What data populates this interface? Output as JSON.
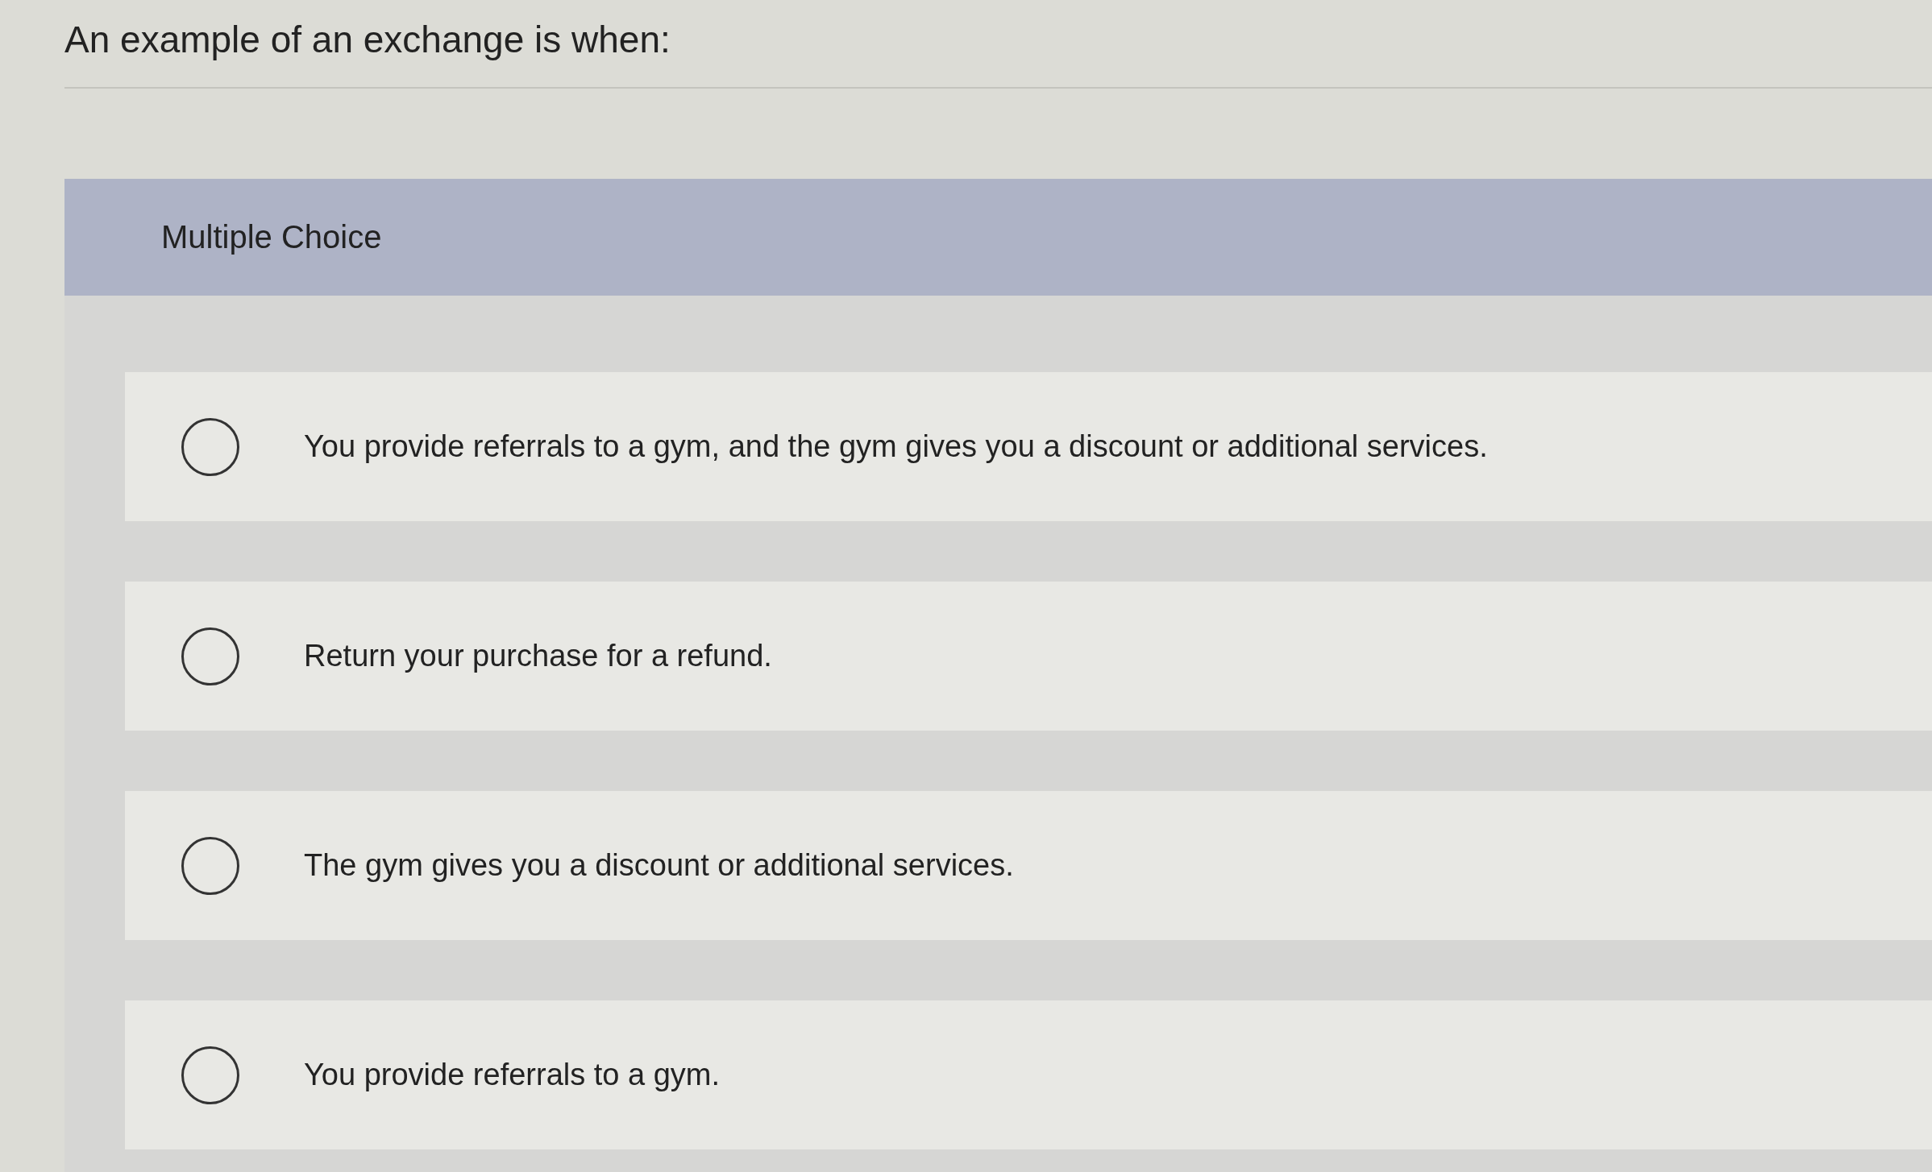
{
  "question": "An example of an exchange is when:",
  "section_label": "Multiple Choice",
  "options": [
    {
      "text": "You provide referrals to a gym, and the gym gives you a discount or additional services.",
      "selected": false
    },
    {
      "text": "Return your purchase for a refund.",
      "selected": false
    },
    {
      "text": "The gym gives you a discount or additional services.",
      "selected": false
    },
    {
      "text": "You provide referrals to a gym.",
      "selected": false
    }
  ]
}
